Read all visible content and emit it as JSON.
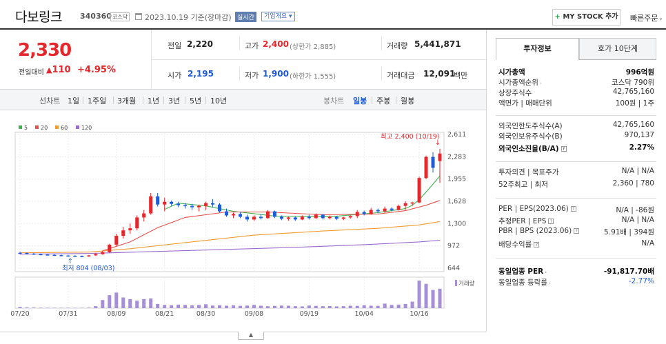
{
  "header": {
    "name": "다보링크",
    "code": "340360",
    "market": "코스닥",
    "date_text": "2023.10.19 기준(장마감)",
    "realtime_label": "실시간",
    "overview_label": "기업개요",
    "mystock_label": "MY STOCK 추가",
    "quick_order_label": "빠른주문"
  },
  "summary": {
    "price": "2,330",
    "change_label": "전일대비",
    "change_value": "110",
    "change_pct": "+4.95%",
    "prev_label": "전일",
    "prev_value": "2,220",
    "high_label": "고가",
    "high_value": "2,400",
    "high_limit": "(상한가 2,885)",
    "volume_label": "거래량",
    "volume_value": "5,441,871",
    "open_label": "시가",
    "open_value": "2,195",
    "low_label": "저가",
    "low_value": "1,900",
    "low_limit": "(하한가 1,555)",
    "amount_label": "거래대금",
    "amount_value": "12,091",
    "amount_unit": "백만"
  },
  "period_bar": {
    "line_chart_label": "선차트",
    "line_items": [
      "1일",
      "1주일",
      "3개월",
      "1년",
      "3년",
      "5년",
      "10년"
    ],
    "candle_chart_label": "봉차트",
    "candle_items": [
      "일봉",
      "주봉",
      "월봉"
    ],
    "candle_active": "일봉"
  },
  "colors": {
    "up": "#e5262b",
    "down": "#1f5bd6",
    "ma5": "#3cb44b",
    "ma20": "#e6504a",
    "ma60": "#f29b30",
    "ma120": "#9b6bd1",
    "volume": "#a58fd6"
  },
  "chart_data": {
    "type": "candlestick",
    "legend": [
      "5",
      "20",
      "60",
      "120"
    ],
    "y_ticks": [
      "2,611",
      "2,283",
      "1,955",
      "1,628",
      "1,300",
      "972",
      "644"
    ],
    "y_tick_values": [
      2611,
      2283,
      1955,
      1628,
      1300,
      972,
      644
    ],
    "ylim": [
      644,
      2611
    ],
    "x_ticks": [
      "07/20",
      "07/31",
      "08/09",
      "08/21",
      "08/30",
      "09/08",
      "09/19",
      "10/04",
      "10/16"
    ],
    "x_tick_index": [
      0,
      7,
      14,
      21,
      27,
      34,
      42,
      50,
      58
    ],
    "high_annotation": "최고 2,400 (10/19)",
    "low_annotation": "최저 804 (08/03)",
    "volume_label": "거래량",
    "candles": [
      [
        870,
        885,
        850,
        868
      ],
      [
        868,
        875,
        845,
        858
      ],
      [
        858,
        868,
        840,
        850
      ],
      [
        850,
        860,
        835,
        845
      ],
      [
        845,
        852,
        830,
        840
      ],
      [
        840,
        848,
        825,
        835
      ],
      [
        835,
        845,
        820,
        830
      ],
      [
        830,
        840,
        815,
        826
      ],
      [
        826,
        835,
        815,
        822
      ],
      [
        822,
        830,
        804,
        820
      ],
      [
        820,
        838,
        812,
        832
      ],
      [
        832,
        870,
        825,
        850
      ],
      [
        850,
        900,
        842,
        880
      ],
      [
        880,
        1000,
        870,
        990
      ],
      [
        990,
        1150,
        960,
        1120
      ],
      [
        1120,
        1250,
        1080,
        1200
      ],
      [
        1200,
        1300,
        1150,
        1230
      ],
      [
        1230,
        1420,
        1200,
        1390
      ],
      [
        1390,
        1500,
        1330,
        1450
      ],
      [
        1450,
        1750,
        1430,
        1700
      ],
      [
        1700,
        1750,
        1550,
        1580
      ],
      [
        1580,
        1680,
        1480,
        1620
      ],
      [
        1620,
        1640,
        1560,
        1590
      ],
      [
        1590,
        1620,
        1540,
        1570
      ],
      [
        1570,
        1600,
        1520,
        1560
      ],
      [
        1560,
        1590,
        1500,
        1540
      ],
      [
        1540,
        1580,
        1480,
        1560
      ],
      [
        1560,
        1620,
        1500,
        1600
      ],
      [
        1600,
        1660,
        1540,
        1580
      ],
      [
        1580,
        1600,
        1460,
        1480
      ],
      [
        1480,
        1520,
        1400,
        1420
      ],
      [
        1420,
        1460,
        1380,
        1440
      ],
      [
        1440,
        1470,
        1380,
        1400
      ],
      [
        1400,
        1430,
        1330,
        1360
      ],
      [
        1360,
        1420,
        1340,
        1400
      ],
      [
        1400,
        1440,
        1360,
        1380
      ],
      [
        1380,
        1500,
        1370,
        1480
      ],
      [
        1480,
        1490,
        1380,
        1400
      ],
      [
        1400,
        1420,
        1350,
        1370
      ],
      [
        1370,
        1400,
        1340,
        1390
      ],
      [
        1390,
        1400,
        1340,
        1360
      ],
      [
        1360,
        1420,
        1350,
        1400
      ],
      [
        1400,
        1430,
        1360,
        1380
      ],
      [
        1380,
        1450,
        1370,
        1430
      ],
      [
        1430,
        1440,
        1360,
        1380
      ],
      [
        1380,
        1420,
        1360,
        1400
      ],
      [
        1400,
        1410,
        1350,
        1370
      ],
      [
        1370,
        1400,
        1350,
        1390
      ],
      [
        1390,
        1420,
        1370,
        1410
      ],
      [
        1410,
        1500,
        1380,
        1470
      ],
      [
        1470,
        1490,
        1420,
        1440
      ],
      [
        1440,
        1530,
        1430,
        1500
      ],
      [
        1500,
        1520,
        1450,
        1480
      ],
      [
        1480,
        1550,
        1460,
        1520
      ],
      [
        1520,
        1540,
        1480,
        1500
      ],
      [
        1500,
        1580,
        1490,
        1560
      ],
      [
        1560,
        1630,
        1500,
        1600
      ],
      [
        1600,
        1620,
        1560,
        1610
      ],
      [
        1610,
        1990,
        1600,
        1970
      ],
      [
        1970,
        2300,
        1950,
        2280
      ],
      [
        2280,
        2350,
        2050,
        2120
      ],
      [
        2220,
        2400,
        1900,
        2330
      ]
    ],
    "volumes": [
      40,
      20,
      18,
      15,
      12,
      12,
      10,
      12,
      10,
      10,
      15,
      60,
      250,
      400,
      480,
      330,
      280,
      230,
      280,
      300,
      130,
      100,
      90,
      110,
      100,
      85,
      100,
      120,
      80,
      90,
      75,
      85,
      70,
      80,
      100,
      75,
      60,
      70,
      80,
      75,
      60,
      55,
      80,
      70,
      60,
      65,
      55,
      60,
      75,
      70,
      90,
      75,
      70,
      140,
      100,
      110,
      130,
      200,
      850,
      750,
      560,
      600
    ],
    "ma_series": {
      "5": [
        [
          21,
          1510
        ],
        [
          23,
          1600
        ],
        [
          27,
          1560
        ],
        [
          31,
          1480
        ],
        [
          37,
          1410
        ],
        [
          45,
          1400
        ],
        [
          52,
          1460
        ],
        [
          56,
          1520
        ],
        [
          57,
          1570
        ],
        [
          58,
          1650
        ],
        [
          60,
          1880
        ],
        [
          61,
          2000
        ]
      ],
      "20": [
        [
          12,
          900
        ],
        [
          16,
          1030
        ],
        [
          20,
          1240
        ],
        [
          24,
          1390
        ],
        [
          30,
          1470
        ],
        [
          36,
          1470
        ],
        [
          44,
          1430
        ],
        [
          52,
          1440
        ],
        [
          56,
          1490
        ],
        [
          59,
          1570
        ],
        [
          61,
          1640
        ]
      ],
      "60": [
        [
          0,
          870
        ],
        [
          10,
          880
        ],
        [
          16,
          930
        ],
        [
          24,
          1020
        ],
        [
          34,
          1130
        ],
        [
          44,
          1190
        ],
        [
          52,
          1230
        ],
        [
          58,
          1280
        ],
        [
          61,
          1330
        ]
      ],
      "120": [
        [
          0,
          850
        ],
        [
          10,
          860
        ],
        [
          20,
          890
        ],
        [
          30,
          920
        ],
        [
          40,
          950
        ],
        [
          50,
          990
        ],
        [
          58,
          1030
        ],
        [
          61,
          1055
        ]
      ]
    }
  },
  "right_panel": {
    "tab_invest": "투자정보",
    "tab_hoga": "호가 10단계",
    "rows": [
      {
        "k": "시가총액",
        "v": "996억원",
        "bold": true
      },
      {
        "k": "시가총액순위",
        "v": "코스닥 790위",
        "arrow": true
      },
      {
        "k": "상장주식수",
        "v": "42,765,160"
      },
      {
        "k": "액면가 | 매매단위",
        "v": "100원 | 1주"
      },
      {
        "k": "외국인한도주식수(A)",
        "v": "42,765,160"
      },
      {
        "k": "외국인보유주식수(B)",
        "v": "970,137"
      },
      {
        "k": "외국인소진율(B/A)",
        "v": "2.27%",
        "bold": true,
        "q": true
      },
      {
        "k": "투자의견 | 목표주가",
        "v": "N/A | N/A"
      },
      {
        "k": "52주최고 | 최저",
        "v": "2,360 | 780"
      },
      {
        "k": "PER | EPS(2023.06)",
        "v": "N/A | -86원",
        "q": true
      },
      {
        "k": "추정PER | EPS",
        "v": "N/A | N/A",
        "q": true
      },
      {
        "k": "PBR | BPS (2023.06)",
        "v": "5.91배 | 394원",
        "q": true
      },
      {
        "k": "배당수익률",
        "v": "N/A",
        "q": true
      },
      {
        "k": "동일업종 PER",
        "v": "-91,817.70배",
        "bold": true,
        "arrow": true
      },
      {
        "k": "동일업종 등락률",
        "v": "-2.77%",
        "arrow": true,
        "vcolor": "#1f5bd6"
      }
    ],
    "row_y": [
      53,
      68,
      83,
      98,
      131,
      146,
      164,
      198,
      216,
      253,
      269,
      285,
      303,
      342,
      358
    ],
    "seps": [
      123,
      190,
      243,
      330
    ]
  }
}
